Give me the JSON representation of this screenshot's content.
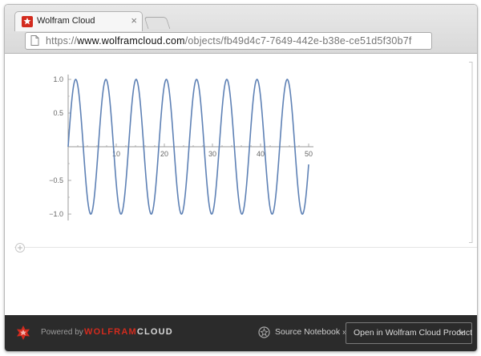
{
  "browser": {
    "tab_title": "Wolfram Cloud",
    "tab_close": "×",
    "url_scheme": "https://",
    "url_domain": "www.wolframcloud.com",
    "url_path": "/objects/fb49d4c7-7649-442e-b38e-ce51d5f30b7f"
  },
  "footer": {
    "powered_by": "Powered by",
    "brand_wolfram": "WOLFRAM",
    "brand_cloud": "CLOUD",
    "source_notebook": "Source Notebook »",
    "open_button": "Open in Wolfram Cloud Product"
  },
  "colors": {
    "accent": "#d32b1e",
    "curve": "#5e81b5",
    "footer_bg": "#2b2b2b"
  },
  "chart_data": {
    "type": "line",
    "function": "sin",
    "x_range": [
      0,
      50
    ],
    "ylim": [
      -1.0,
      1.0
    ],
    "x_ticks": [
      10,
      20,
      30,
      40,
      50
    ],
    "y_ticks": [
      -1.0,
      -0.5,
      0.5,
      1.0
    ],
    "x_tick_labels": [
      "10",
      "20",
      "30",
      "40",
      "50"
    ],
    "y_tick_labels": [
      "−1.0",
      "−0.5",
      "0.5",
      "1.0"
    ],
    "title": "",
    "xlabel": "",
    "ylabel": ""
  }
}
